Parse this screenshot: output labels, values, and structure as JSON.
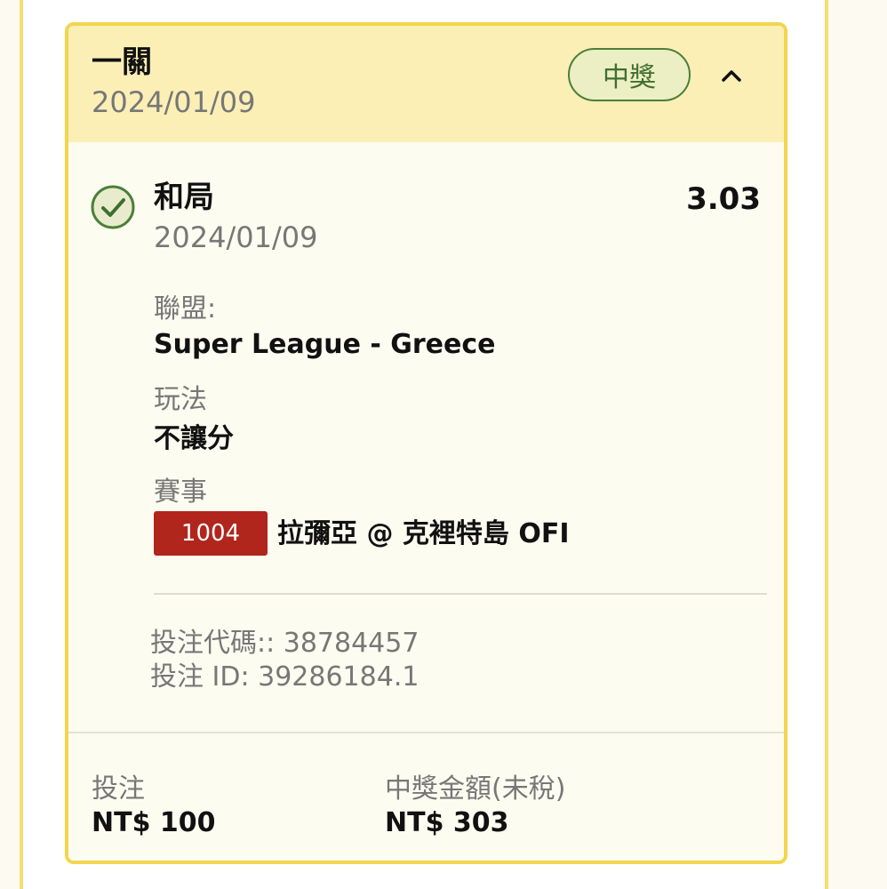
{
  "card": {
    "bet_type": "一關",
    "date": "2024/01/09",
    "result_badge": "中獎"
  },
  "selection": {
    "name": "和局",
    "date": "2024/01/09",
    "odds": "3.03"
  },
  "details": {
    "league_label": "聯盟:",
    "league_value": "Super League - Greece",
    "market_label": "玩法",
    "market_value": "不讓分",
    "event_label": "賽事",
    "event_code": "1004",
    "event_name": "拉彌亞 @ 克裡特島 OFI"
  },
  "ids": {
    "bet_code": "投注代碼:: 38784457",
    "bet_id": "投注 ID: 39286184.1"
  },
  "footer": {
    "stake_label": "投注",
    "stake_value": "NT$ 100",
    "payout_label": "中獎金額(未稅)",
    "payout_value": "NT$ 303"
  },
  "colors": {
    "accent_border": "#f3d54e",
    "header_bg": "#fbefb6",
    "win_green": "#4c7f3a",
    "code_red": "#b0261c"
  },
  "icons": {
    "status": "check-circle-icon",
    "toggle": "chevron-up-icon"
  }
}
